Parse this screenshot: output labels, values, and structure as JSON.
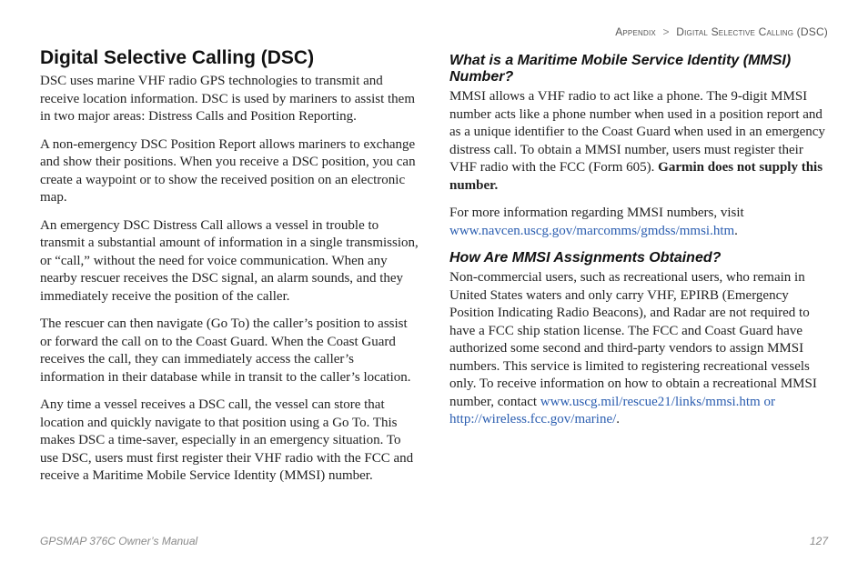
{
  "breadcrumb": {
    "a": "Appendix",
    "sep": ">",
    "b": "Digital Selective Calling",
    "c": "(DSC)"
  },
  "left": {
    "h1": "Digital Selective Calling (DSC)",
    "p1": "DSC uses marine VHF radio GPS technologies to transmit and receive location information. DSC is used by mariners to assist them in two major areas: Distress Calls and Position Reporting.",
    "p2": "A non-emergency DSC Position Report allows mariners to exchange and show their positions. When you receive a DSC position, you can create a waypoint or to show the received position on an electronic map.",
    "p3": "An emergency DSC Distress Call allows a vessel in trouble to transmit a substantial amount of information in a single transmission, or “call,” without the need for voice communication. When any nearby rescuer receives the DSC signal, an alarm sounds, and they immediately receive the position of the caller.",
    "p4": "The rescuer can then navigate (Go To) the caller’s position to assist or forward the call on to the Coast Guard. When the Coast Guard receives the call, they can immediately access the caller’s information in their database while in transit to the caller’s location.",
    "p5": "Any time a vessel receives a DSC call, the vessel can store that location and quickly navigate to that position using a Go To. This makes DSC a time-saver, especially in an emergency situation. To use DSC, users must first register their VHF radio with the FCC and receive a Maritime Mobile Service Identity (MMSI) number."
  },
  "right": {
    "h2a": "What is a Maritime Mobile Service Identity (MMSI) Number?",
    "p1a": "MMSI allows a VHF radio to act like a phone. The 9-digit MMSI number acts like a phone number when used in a position report and as a unique identifier to the Coast Guard when used in an emergency distress call. To obtain a MMSI number, users must register their VHF radio with the FCC (Form 605). ",
    "p1b": "Garmin does not supply this number.",
    "p2a": "For more information regarding MMSI numbers, visit ",
    "p2link": "www.navcen.uscg.gov/marcomms/gmdss/mmsi.htm",
    "p2b": ".",
    "h2b": "How Are MMSI Assignments Obtained?",
    "p3a": "Non-commercial users, such as recreational users, who remain in United States waters and only carry VHF, EPIRB (Emergency Position Indicating Radio Beacons), and Radar are not required to have a FCC ship station license. The FCC and Coast Guard have authorized some second and third-party vendors to assign MMSI numbers. This service is limited to registering recreational vessels only. To receive information on how to obtain a recreational MMSI number, contact ",
    "p3link": "www.uscg.mil/rescue21/links/mmsi.htm or http://wireless.fcc.gov/marine/",
    "p3b": "."
  },
  "footer": {
    "left": "GPSMAP 376C Owner’s Manual",
    "right": "127"
  }
}
